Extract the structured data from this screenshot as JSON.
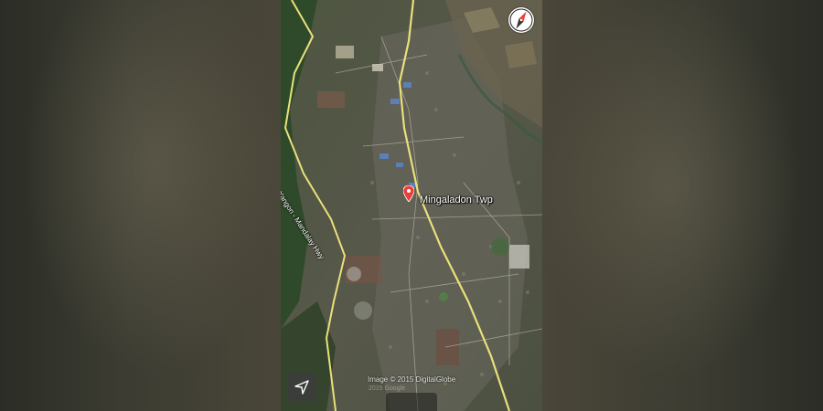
{
  "map": {
    "place_name": "Mingaladon Twp",
    "road_name": "Yangon - Mandalay Hwy",
    "attribution": "Image © 2015 DigitalGlobe",
    "attribution_secondary": "2015 Google",
    "map_type": "satellite",
    "marker_color": "#e8413a",
    "road_color": "#e9e07a"
  },
  "controls": {
    "compass_icon": "compass-icon",
    "location_icon": "location-arrow-icon"
  }
}
